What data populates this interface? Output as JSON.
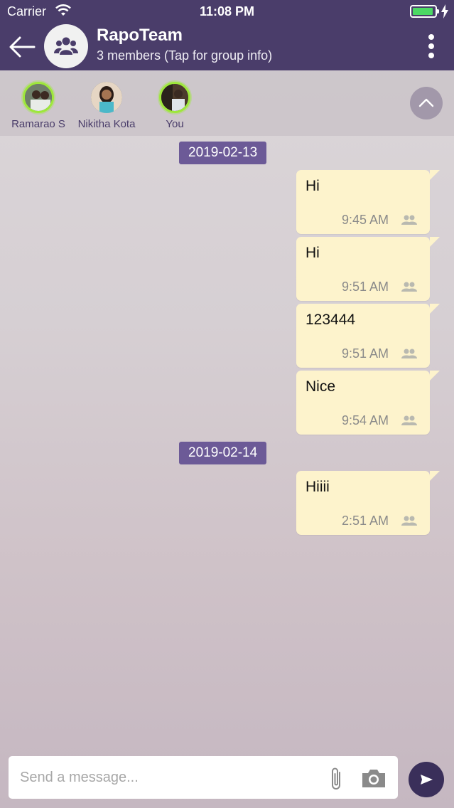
{
  "status_bar": {
    "carrier": "Carrier",
    "time": "11:08 PM"
  },
  "header": {
    "title": "RapoTeam",
    "subtitle": "3 members (Tap for group info)"
  },
  "members": [
    {
      "name": "Ramarao S"
    },
    {
      "name": "Nikitha Kota"
    },
    {
      "name": "You"
    }
  ],
  "messages": {
    "date_1": "2019-02-13",
    "date_2": "2019-02-14",
    "items": [
      {
        "text": "Hi",
        "time": "9:45 AM"
      },
      {
        "text": "Hi",
        "time": "9:51 AM"
      },
      {
        "text": "123444",
        "time": "9:51 AM"
      },
      {
        "text": "Nice",
        "time": "9:54 AM"
      },
      {
        "text": "Hiiii",
        "time": "2:51 AM"
      }
    ]
  },
  "composer": {
    "placeholder": "Send a message..."
  },
  "colors": {
    "header_bg": "#4a3d6a",
    "date_chip_bg": "#6c5a97",
    "bubble_bg": "#fdf3cc",
    "online_ring": "#9ee83a"
  },
  "icons": [
    "back-arrow-icon",
    "group-icon",
    "more-vertical-icon",
    "chevron-up-icon",
    "group-read-icon",
    "paperclip-icon",
    "camera-icon",
    "send-icon"
  ]
}
